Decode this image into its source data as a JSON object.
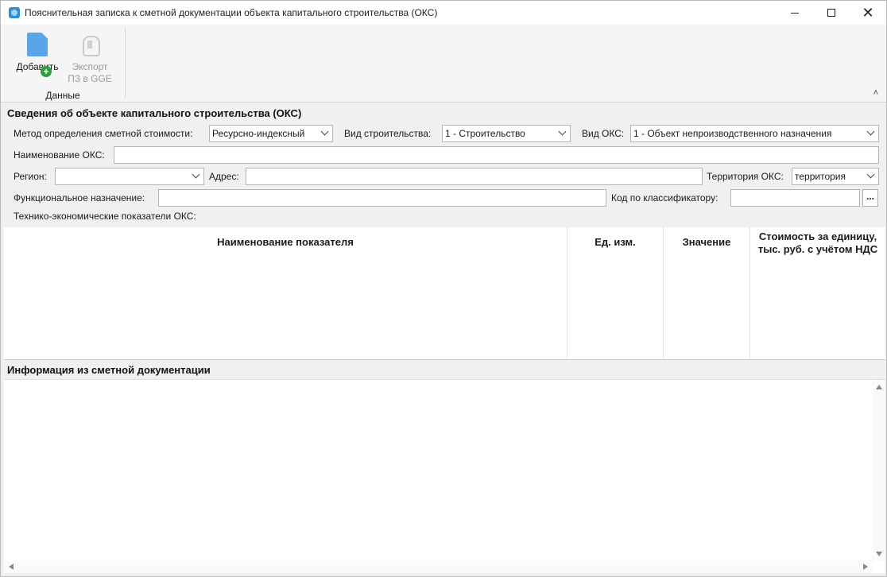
{
  "window": {
    "title": "Пояснительная записка к сметной документации объекта капитального строительства (ОКС)"
  },
  "ribbon": {
    "add_label": "Добавить",
    "export_line1": "Экспорт",
    "export_line2": "ПЗ в GGE",
    "group_label": "Данные",
    "collapse_glyph": "˄"
  },
  "section_oks": {
    "title": "Сведения об объекте капитального строительства (ОКС)",
    "method_label": "Метод определения сметной стоимости:",
    "method_value": "Ресурсно-индексный",
    "build_type_label": "Вид строительства:",
    "build_type_value": "1 - Строительство",
    "oks_type_label": "Вид ОКС:",
    "oks_type_value": "1 - Объект непроизводственного назначения",
    "name_label": "Наименование ОКС:",
    "name_value": "",
    "region_label": "Регион:",
    "region_value": "",
    "address_label": "Адрес:",
    "address_value": "",
    "territory_label": "Территория ОКС:",
    "territory_value": "территория",
    "purpose_label": "Функциональное назначение:",
    "purpose_value": "",
    "classifier_label": "Код по классификатору:",
    "classifier_value": "",
    "ellipsis": "...",
    "indicators_label": "Технико-экономические показатели ОКС:"
  },
  "table": {
    "columns": [
      "Наименование показателя",
      "Ед. изм.",
      "Значение",
      "Стоимость за единицу,",
      "тыс. руб. с учётом НДС"
    ]
  },
  "section_info": {
    "title": "Информация из сметной документации"
  }
}
